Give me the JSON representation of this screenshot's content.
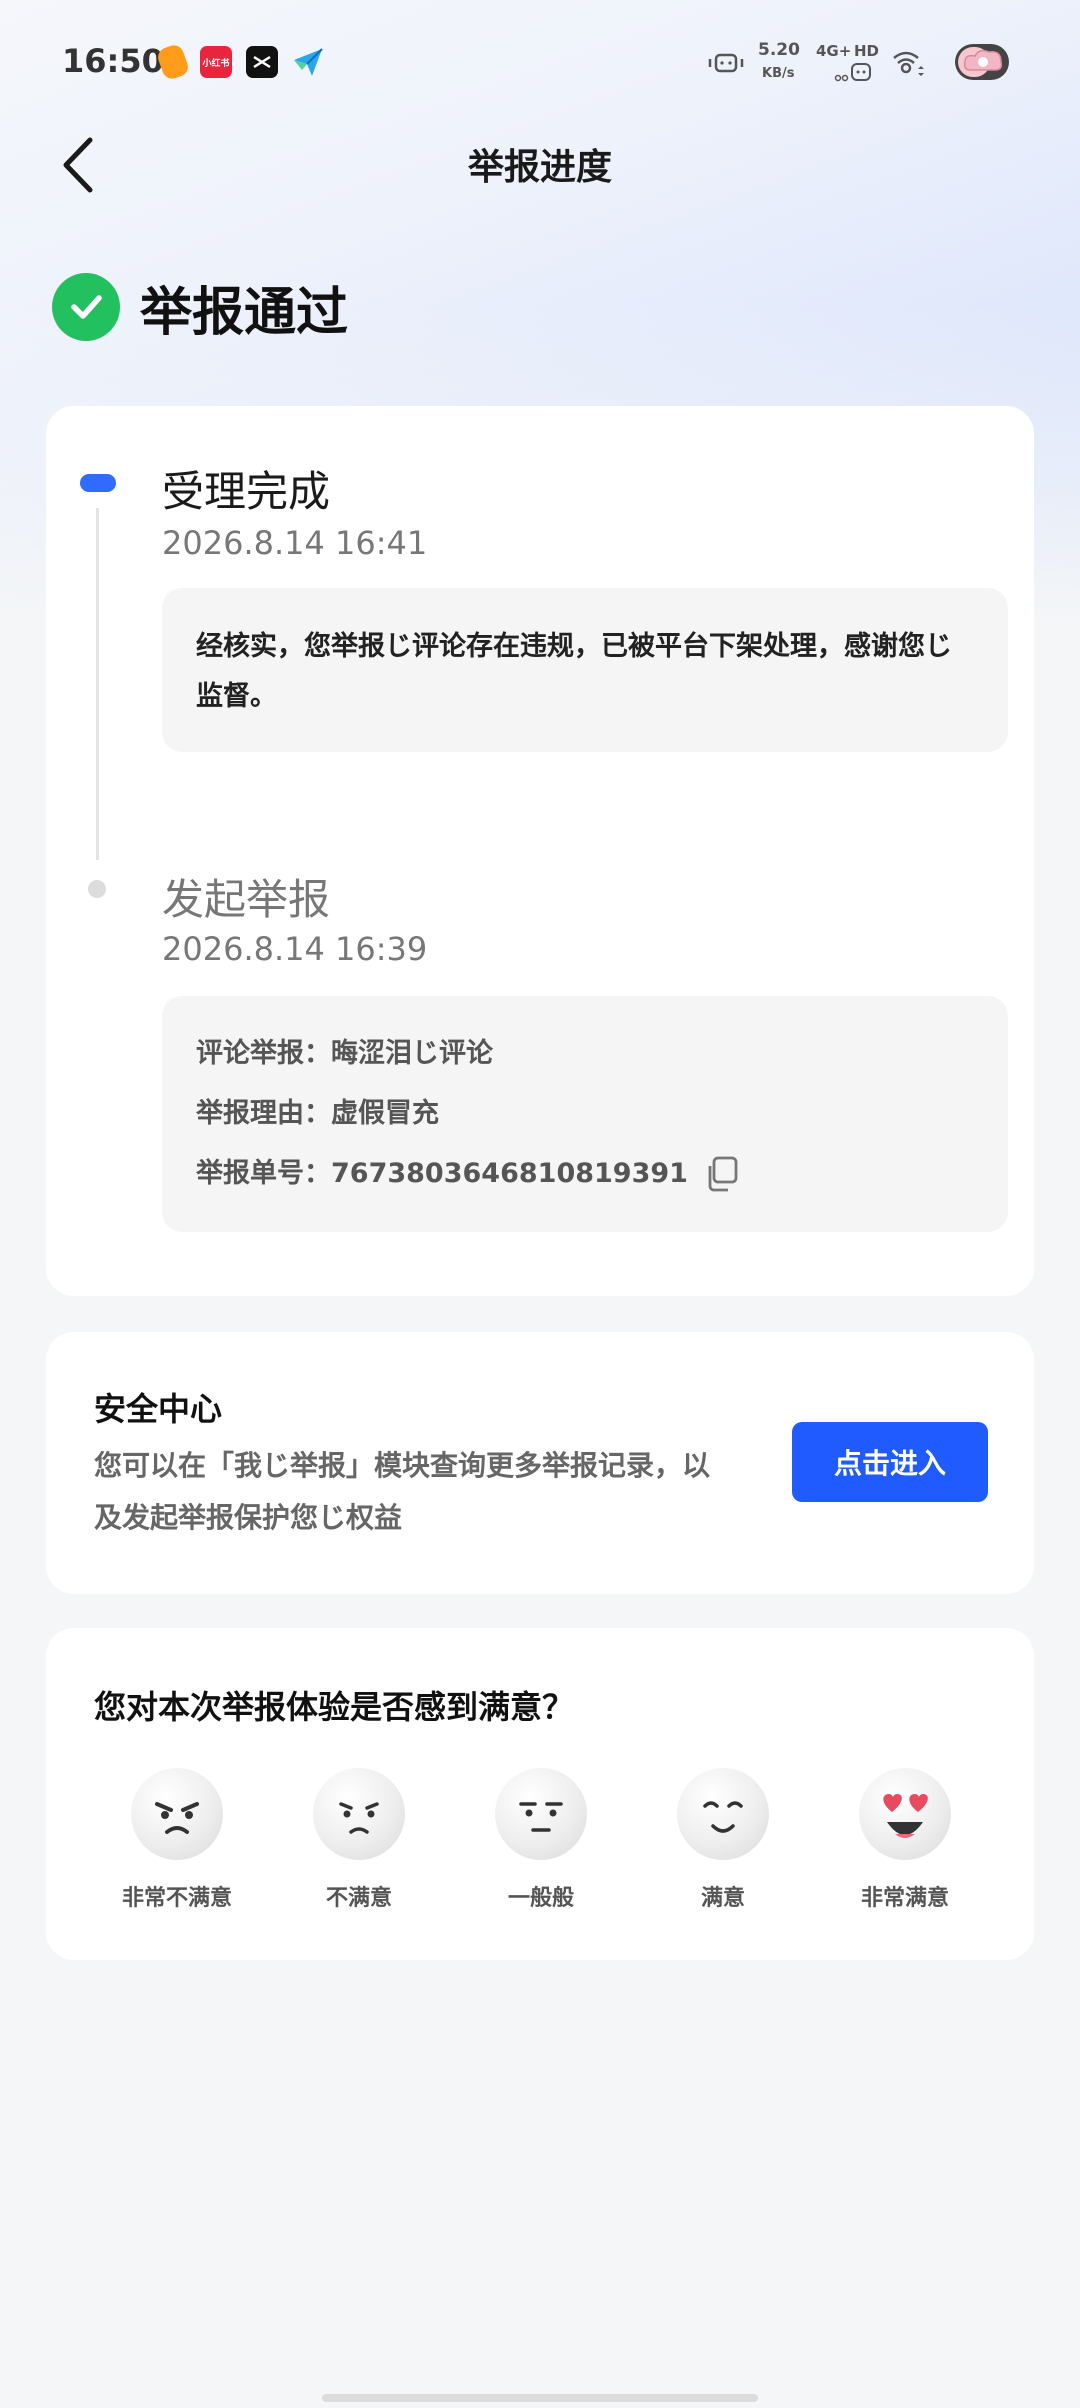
{
  "status_bar": {
    "time": "16:50",
    "app_icons": [
      "app-icon-1",
      "小红书",
      "capcut-icon",
      "paper-plane-icon"
    ],
    "net_speed": "5.20",
    "net_unit": "KB/s",
    "signal": "4G+",
    "hd": "HD"
  },
  "header": {
    "title": "举报进度"
  },
  "result": {
    "text": "举报通过"
  },
  "timeline": {
    "steps": [
      {
        "title": "受理完成",
        "time": "2026.8.14 16:41",
        "message": "经核实，您举报じ评论存在违规，已被平台下架处理，感谢您じ监督。"
      },
      {
        "title": "发起举报",
        "time": "2026.8.14 16:39",
        "details": [
          {
            "label": "评论举报：",
            "value": "晦涩泪じ评论"
          },
          {
            "label": "举报理由：",
            "value": "虚假冒充"
          },
          {
            "label": "举报单号：",
            "value": "7673803646810819391"
          }
        ]
      }
    ]
  },
  "safety": {
    "title": "安全中心",
    "description": "您可以在「我じ举报」模块查询更多举报记录，以及发起举报保护您じ权益",
    "button": "点击进入"
  },
  "survey": {
    "question": "您对本次举报体验是否感到满意？",
    "options": [
      {
        "label": "非常不满意",
        "icon": "very-unsatisfied-face"
      },
      {
        "label": "不满意",
        "icon": "unsatisfied-face"
      },
      {
        "label": "一般般",
        "icon": "neutral-face"
      },
      {
        "label": "满意",
        "icon": "satisfied-face"
      },
      {
        "label": "非常满意",
        "icon": "very-satisfied-face"
      }
    ]
  },
  "colors": {
    "accent": "#1f5bff",
    "success": "#22c05e",
    "timeline_active": "#2f6bff"
  }
}
